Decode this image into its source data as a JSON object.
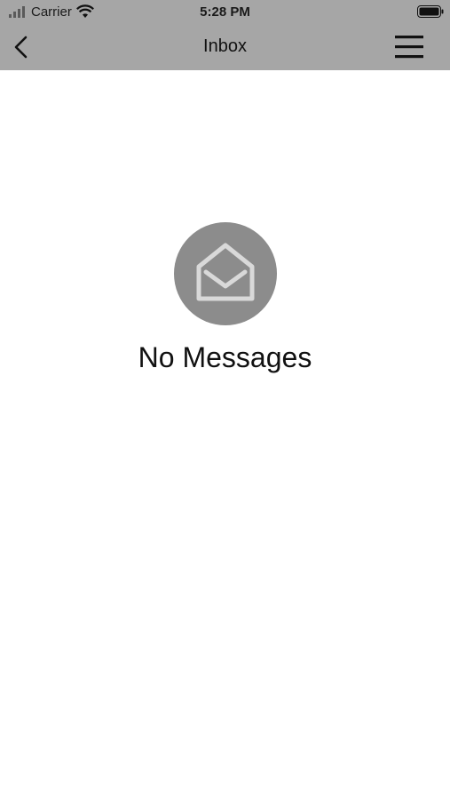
{
  "status_bar": {
    "carrier": "Carrier",
    "time": "5:28 PM",
    "icons": [
      "signal-icon",
      "wifi-icon",
      "battery-icon"
    ]
  },
  "nav": {
    "title": "Inbox",
    "back_icon": "chevron-left-icon",
    "menu_icon": "hamburger-menu-icon"
  },
  "empty_state": {
    "icon": "open-envelope-icon",
    "label": "No Messages"
  },
  "colors": {
    "topbar_bg": "#a6a6a6",
    "icon_circle_bg": "#8c8c8c",
    "icon_stroke": "#d9d9d9",
    "page_bg": "#ffffff"
  }
}
